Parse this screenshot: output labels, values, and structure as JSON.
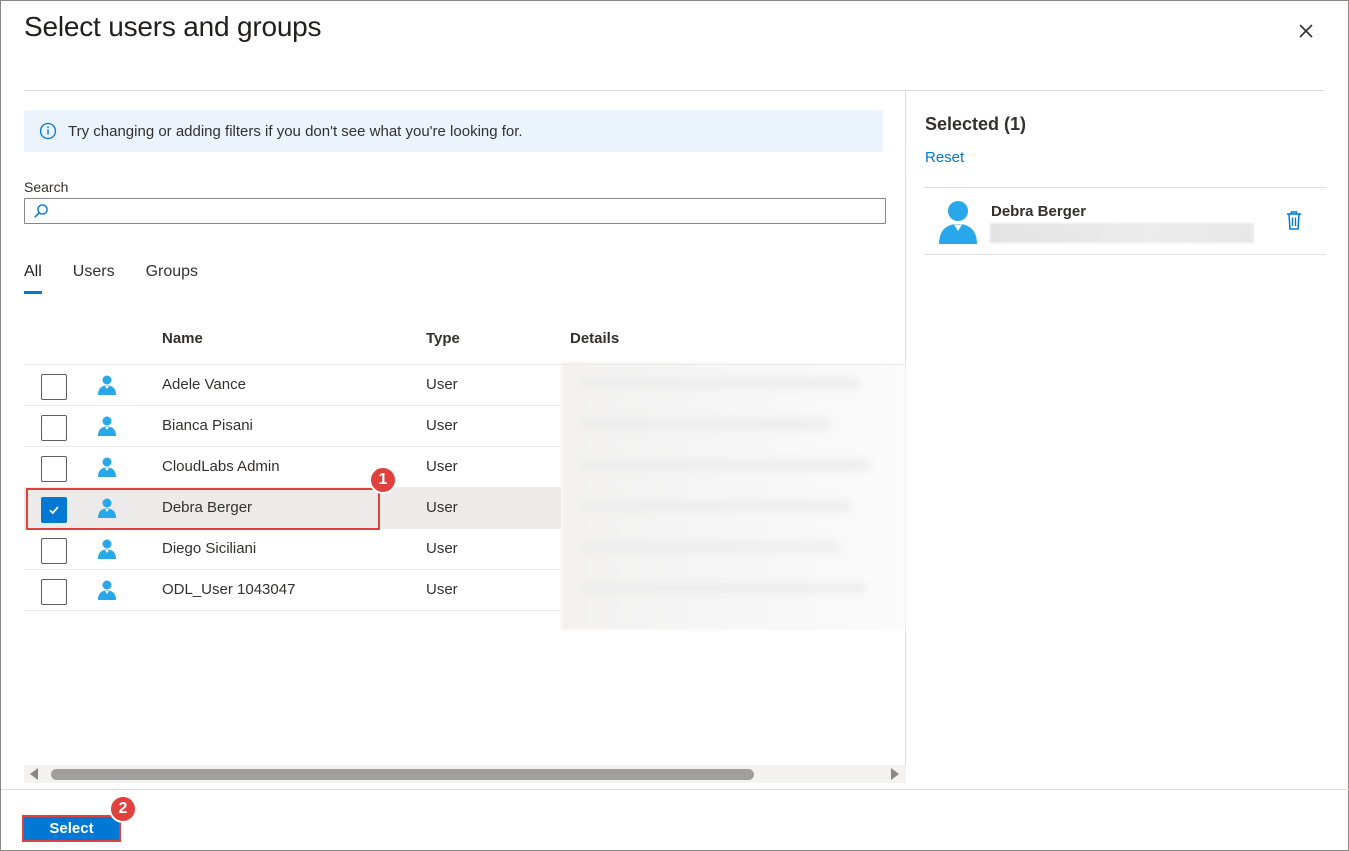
{
  "dialog": {
    "title": "Select users and groups",
    "close_icon": "close-icon"
  },
  "info": {
    "text": "Try changing or adding filters if you don't see what you're looking for.",
    "icon": "info-icon"
  },
  "search": {
    "label": "Search",
    "value": "",
    "placeholder": "",
    "icon": "search-icon"
  },
  "tabs": [
    {
      "label": "All",
      "active": true
    },
    {
      "label": "Users",
      "active": false
    },
    {
      "label": "Groups",
      "active": false
    }
  ],
  "table": {
    "headers": {
      "name": "Name",
      "type": "Type",
      "details": "Details"
    },
    "rows": [
      {
        "name": "Adele Vance",
        "type": "User",
        "checked": false
      },
      {
        "name": "Bianca Pisani",
        "type": "User",
        "checked": false
      },
      {
        "name": "CloudLabs Admin",
        "type": "User",
        "checked": false
      },
      {
        "name": "Debra Berger",
        "type": "User",
        "checked": true
      },
      {
        "name": "Diego Siciliani",
        "type": "User",
        "checked": false
      },
      {
        "name": "ODL_User 1043047",
        "type": "User",
        "checked": false
      }
    ]
  },
  "selected_panel": {
    "header": "Selected (1)",
    "reset_label": "Reset",
    "items": [
      {
        "name": "Debra Berger"
      }
    ]
  },
  "footer": {
    "select_label": "Select"
  },
  "callouts": {
    "one": "1",
    "two": "2"
  },
  "colors": {
    "accent": "#0078d4",
    "callout": "#e0403e",
    "user_icon": "#28a8ea"
  }
}
